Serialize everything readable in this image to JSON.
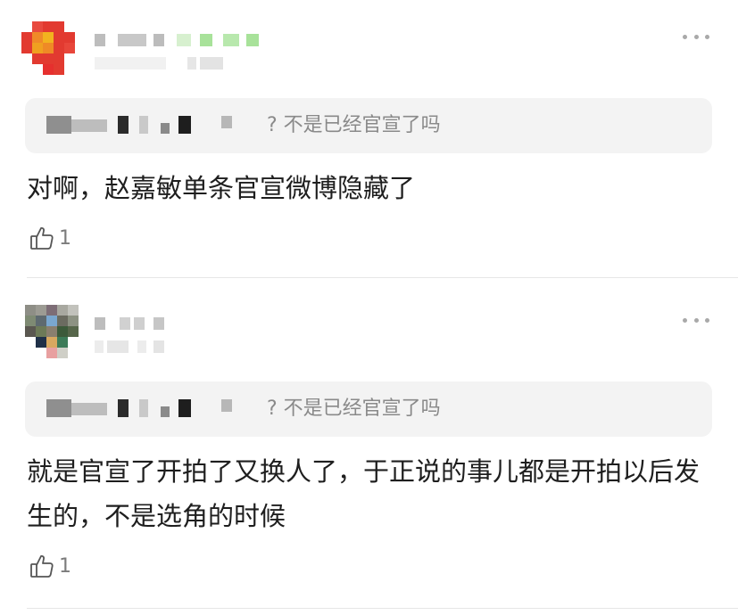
{
  "comments": [
    {
      "quote_text": "? 不是已经官宣了吗",
      "body": "对啊，赵嘉敏单条官宣微博隐藏了",
      "likes": "1",
      "icons": {
        "like": "thumbs-up-icon",
        "more": "more-dots-icon"
      }
    },
    {
      "quote_text": "? 不是已经官宣了吗",
      "body": "就是官宣了开拍了又换人了，于正说的事儿都是开拍以后发生的，不是选角的时候",
      "likes": "1",
      "icons": {
        "like": "thumbs-up-icon",
        "more": "more-dots-icon"
      }
    }
  ],
  "colors": {
    "quote_bg": "#f3f3f3",
    "quote_text": "#8a8a8a",
    "body_text": "#1e1e1e",
    "meta_text": "#7c7c7c",
    "divider": "#e6e6e6"
  }
}
